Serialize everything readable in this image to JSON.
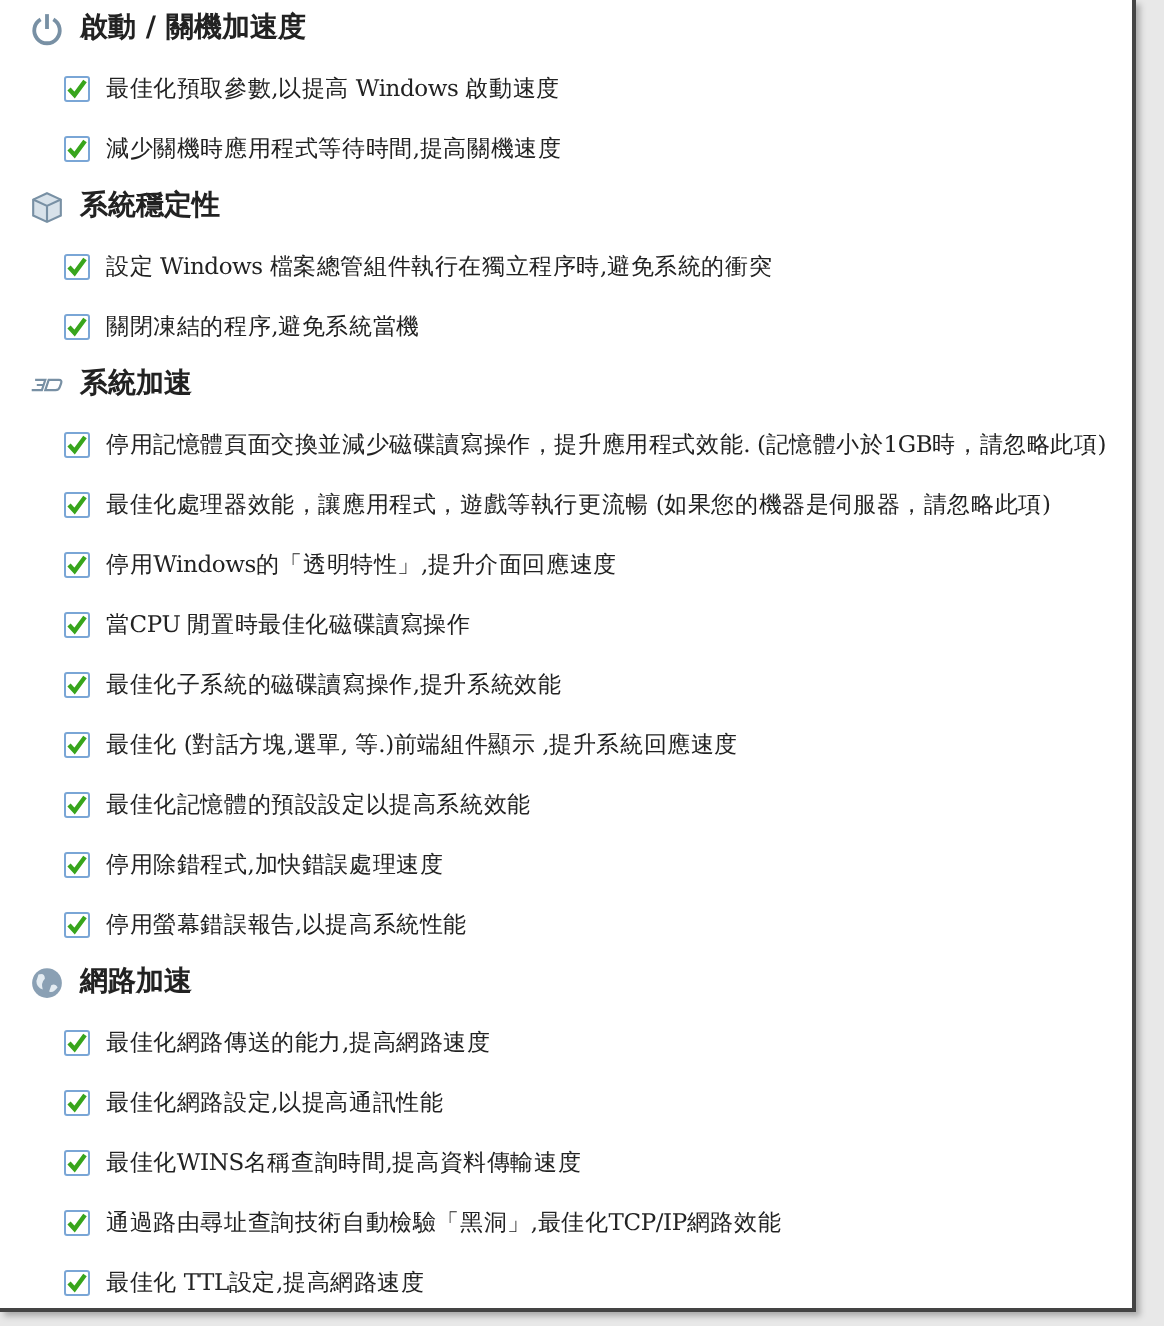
{
  "sections": [
    {
      "title": "啟動 / 關機加速度",
      "items": [
        {
          "label": "最佳化預取參數,以提高 Windows 啟動速度",
          "checked": true
        },
        {
          "label": "減少關機時應用程式等待時間,提高關機速度",
          "checked": true
        }
      ]
    },
    {
      "title": "系統穩定性",
      "items": [
        {
          "label": "設定 Windows 檔案總管組件執行在獨立程序時,避免系統的衝突",
          "checked": true
        },
        {
          "label": "關閉凍結的程序,避免系統當機",
          "checked": true
        }
      ]
    },
    {
      "title": "系統加速",
      "items": [
        {
          "label": "停用記憶體頁面交換並減少磁碟讀寫操作，提升應用程式效能. (記憶體小於1GB時，請忽略此項)",
          "checked": true
        },
        {
          "label": "最佳化處理器效能，讓應用程式，遊戲等執行更流暢 (如果您的機器是伺服器，請忽略此項)",
          "checked": true
        },
        {
          "label": "停用Windows的「透明特性」,提升介面回應速度",
          "checked": true
        },
        {
          "label": "當CPU 閒置時最佳化磁碟讀寫操作",
          "checked": true
        },
        {
          "label": "最佳化子系統的磁碟讀寫操作,提升系統效能",
          "checked": true
        },
        {
          "label": "最佳化 (對話方塊,選單, 等.)前端組件顯示 ,提升系統回應速度",
          "checked": true
        },
        {
          "label": "最佳化記憶體的預設設定以提高系統效能",
          "checked": true
        },
        {
          "label": "停用除錯程式,加快錯誤處理速度",
          "checked": true
        },
        {
          "label": "停用螢幕錯誤報告,以提高系統性能",
          "checked": true
        }
      ]
    },
    {
      "title": "網路加速",
      "items": [
        {
          "label": "最佳化網路傳送的能力,提高網路速度",
          "checked": true
        },
        {
          "label": "最佳化網路設定,以提高通訊性能",
          "checked": true
        },
        {
          "label": "最佳化WINS名稱查詢時間,提高資料傳輸速度",
          "checked": true
        },
        {
          "label": "通過路由尋址查詢技術自動檢驗「黑洞」,最佳化TCP/IP網路效能",
          "checked": true
        },
        {
          "label": "最佳化 TTL設定,提高網路速度",
          "checked": true
        }
      ]
    }
  ]
}
